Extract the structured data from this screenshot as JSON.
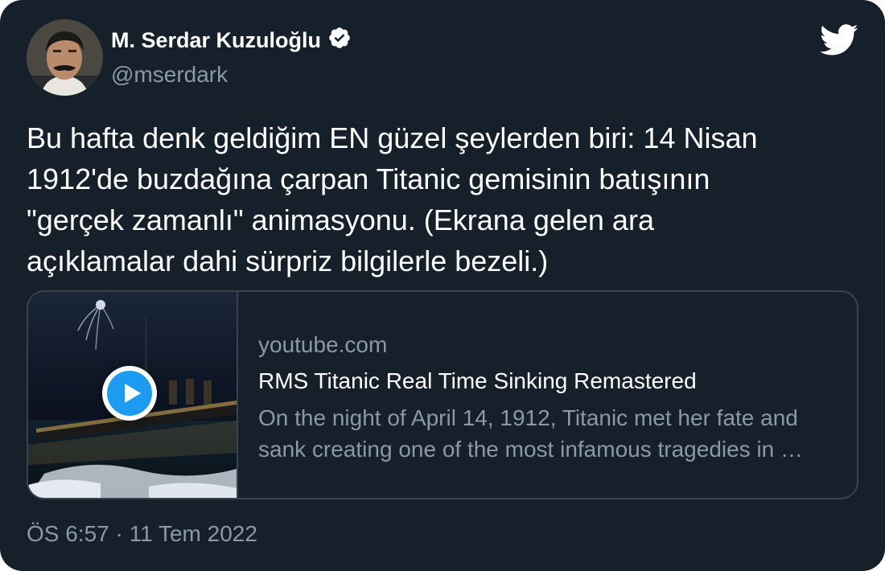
{
  "author": {
    "name": "M. Serdar Kuzuloğlu",
    "handle": "@mserdark",
    "verified": true,
    "avatar_icon": "profile-photo"
  },
  "brand_icon": "twitter-bird-icon",
  "tweet": {
    "lines": [
      "Bu hafta denk geldiğim EN güzel şeylerden biri: 14 Nisan",
      "1912'de buzdağına çarpan Titanic gemisinin batışının",
      "\"gerçek zamanlı\" animasyonu. (Ekrana gelen ara",
      "açıklamalar dahi sürpriz bilgilerle bezeli.)"
    ]
  },
  "link_card": {
    "domain": "youtube.com",
    "title": "RMS Titanic Real Time Sinking Remastered",
    "description_lines": [
      "On the night of April 14, 1912, Titanic met her fate and",
      "sank creating one of the most infamous tragedies in …"
    ],
    "thumbnail_icon": "video-thumbnail-titanic",
    "play_icon": "play-icon"
  },
  "timestamp": "ÖS 6:57 · 11 Tem 2022",
  "colors": {
    "background": "#15202b",
    "text": "#ffffff",
    "secondary_text": "#8b98a5",
    "border": "#38444d",
    "accent": "#1d9bf0"
  }
}
